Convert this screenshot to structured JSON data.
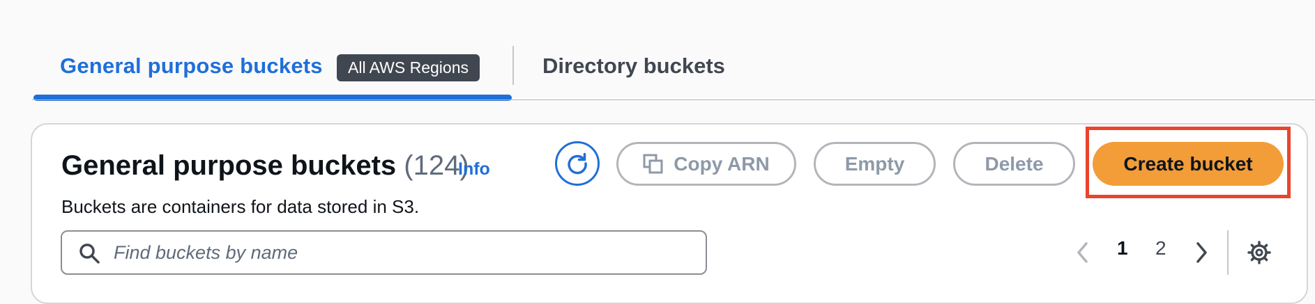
{
  "tabs": {
    "general_label": "General purpose buckets",
    "region_badge": "All AWS Regions",
    "directory_label": "Directory buckets"
  },
  "panel": {
    "title": "General purpose buckets",
    "count": "(124)",
    "info_link": "Info",
    "description": "Buckets are containers for data stored in S3."
  },
  "actions": {
    "refresh_icon": "refresh-icon",
    "copy_arn_label": "Copy ARN",
    "copy_icon": "copy-icon",
    "empty_label": "Empty",
    "delete_label": "Delete",
    "create_label": "Create bucket"
  },
  "search": {
    "placeholder": "Find buckets by name",
    "value": ""
  },
  "pagination": {
    "pages": [
      "1",
      "2"
    ],
    "current_page": "1"
  },
  "colors": {
    "accent": "#1f6fd8",
    "primary_button": "#f29d38",
    "highlight_box": "#e8452c",
    "badge_background": "#414750"
  }
}
